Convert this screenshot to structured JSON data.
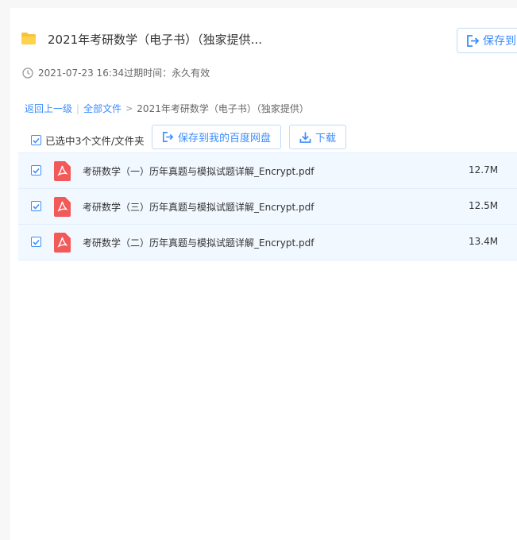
{
  "share": {
    "title": "2021年考研数学（电子书）（独家提供...",
    "save_label": "保存到",
    "created": "2021-07-23 16:34",
    "expiry_label": "过期时间：",
    "expiry_value": "永久有效"
  },
  "breadcrumb": {
    "back": "返回上一级",
    "sep": "|",
    "all_files": "全部文件",
    "arrow": ">",
    "current": "2021年考研数学（电子书）（独家提供）"
  },
  "toolbar": {
    "selected": "已选中3个文件/文件夹",
    "save_btn": "保存到我的百度网盘",
    "download_btn": "下载"
  },
  "files": [
    {
      "name": "考研数学（一）历年真题与模拟试题详解_Encrypt.pdf",
      "size": "12.7M",
      "checked": true
    },
    {
      "name": "考研数学（三）历年真题与模拟试题详解_Encrypt.pdf",
      "size": "12.5M",
      "checked": true
    },
    {
      "name": "考研数学（二）历年真题与模拟试题详解_Encrypt.pdf",
      "size": "13.4M",
      "checked": true
    }
  ],
  "colors": {
    "accent": "#3b8cff",
    "pdf_red": "#f25a5a",
    "folder_yellow": "#f7c23c",
    "row_bg": "#f2f8ff"
  }
}
